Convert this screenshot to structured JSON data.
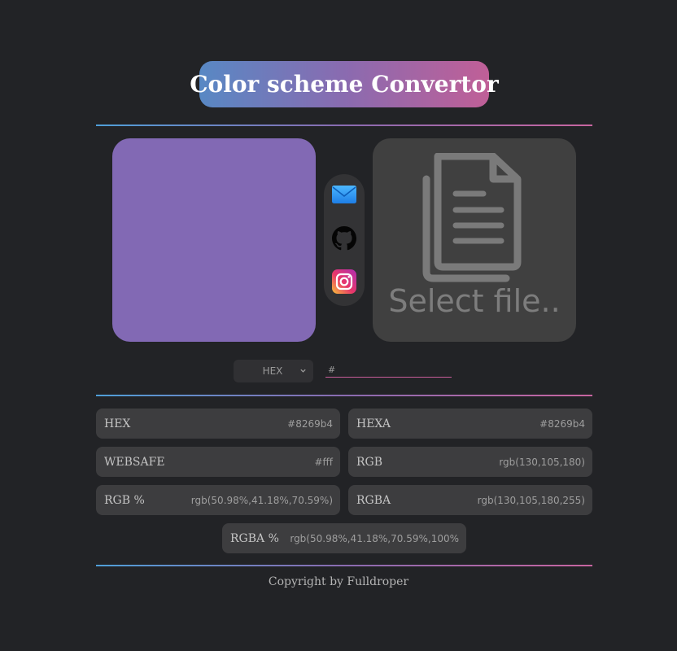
{
  "header": {
    "title": "Color scheme Convertor"
  },
  "preview": {
    "current_color": "#8269b4"
  },
  "social": {
    "items": [
      "mail-icon",
      "github-icon",
      "instagram-icon"
    ]
  },
  "file_picker": {
    "label": "Select file..",
    "icon": "document-icon"
  },
  "input": {
    "format_selected": "HEX",
    "value": "",
    "placeholder": "#"
  },
  "results": [
    {
      "label": "HEX",
      "value": "#8269b4"
    },
    {
      "label": "HEXA",
      "value": "#8269b4"
    },
    {
      "label": "WEBSAFE",
      "value": "#fff"
    },
    {
      "label": "RGB",
      "value": "rgb(130,105,180)"
    },
    {
      "label": "RGB %",
      "value": "rgb(50.98%,41.18%,70.59%)"
    },
    {
      "label": "RGBA",
      "value": "rgb(130,105,180,255)"
    },
    {
      "label": "RGBA %",
      "value": "rgb(50.98%,41.18%,70.59%,100%"
    }
  ],
  "footer": {
    "text": "Copyright by Fulldroper"
  },
  "colors": {
    "background": "#222326",
    "accent_blue": "#4f9fd8",
    "accent_pink": "#c865a0",
    "card": "#3d3d3f"
  }
}
